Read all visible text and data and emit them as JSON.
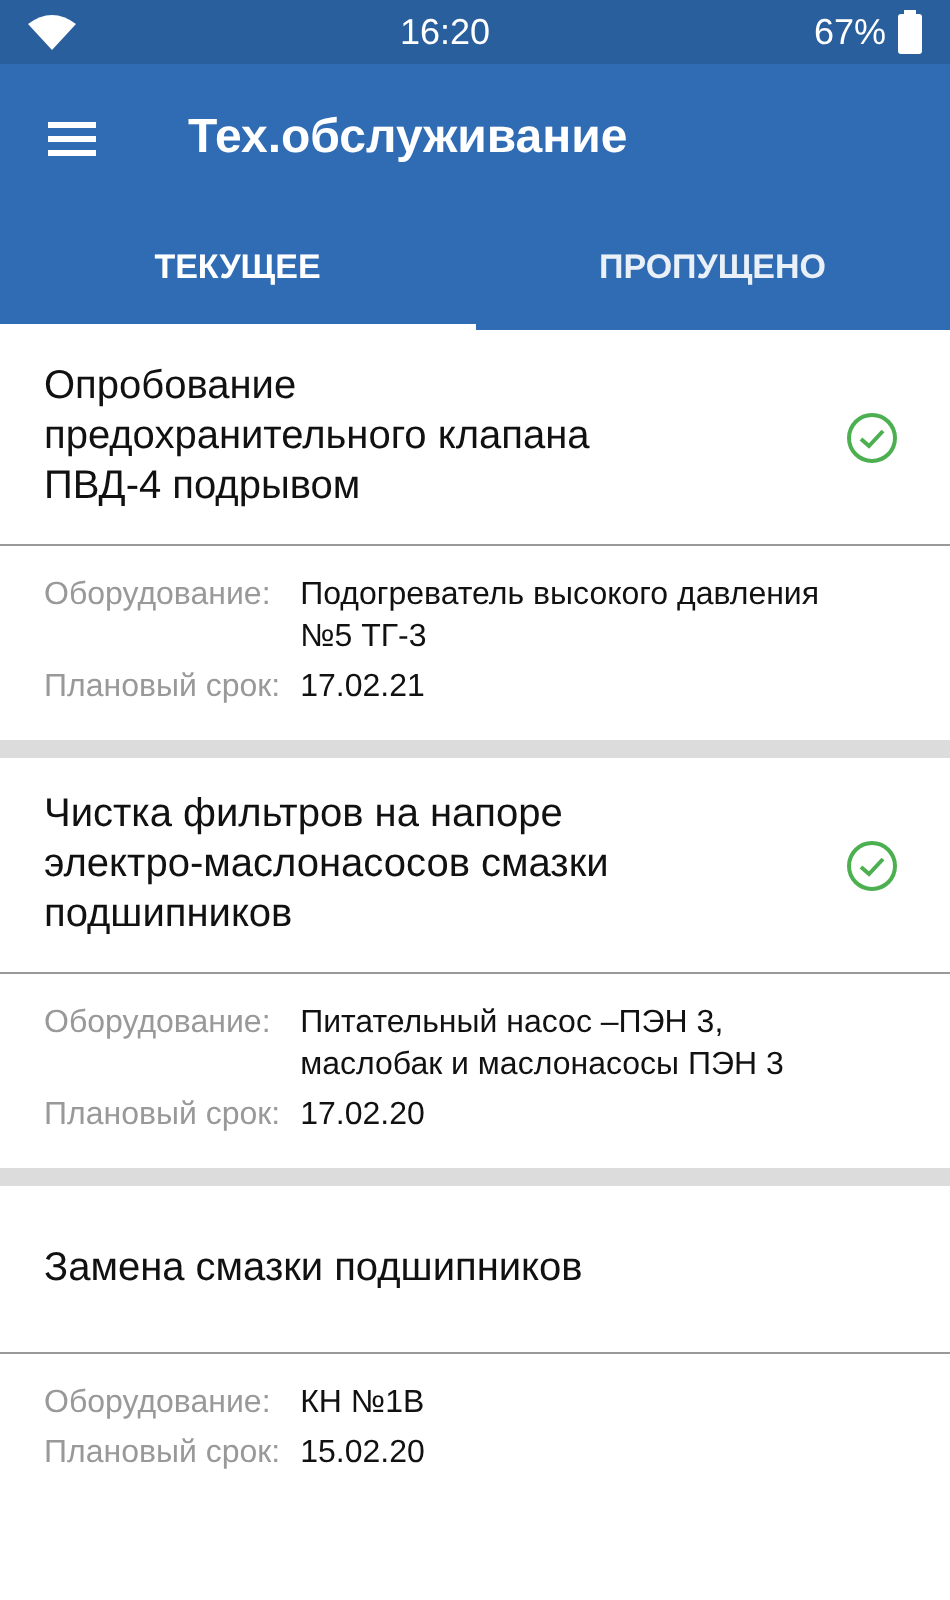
{
  "status_bar": {
    "time": "16:20",
    "battery": "67%"
  },
  "app_bar": {
    "title": "Тех.обслуживание"
  },
  "tabs": [
    {
      "label": "ТЕКУЩЕЕ",
      "selected": true
    },
    {
      "label": "ПРОПУЩЕНО",
      "selected": false
    }
  ],
  "tasks": [
    {
      "title": "Опробование предохранительного клапана ПВД-4 подрывом",
      "done": true,
      "equipment_label": "Оборудование:",
      "equipment": "Подогреватель высокого давления №5 ТГ-3",
      "due_label": "Плановый срок:",
      "due": "17.02.21"
    },
    {
      "title": "Чистка фильтров на напоре электро-маслонасосов смазки подшипников",
      "done": true,
      "equipment_label": "Оборудование:",
      "equipment": "Питательный насос –ПЭН 3, маслобак и маслонасосы ПЭН 3",
      "due_label": "Плановый срок:",
      "due": "17.02.20"
    },
    {
      "title": "Замена смазки подшипников",
      "done": false,
      "equipment_label": "Оборудование:",
      "equipment": "КН №1В",
      "due_label": "Плановый срок:",
      "due": "15.02.20"
    }
  ]
}
